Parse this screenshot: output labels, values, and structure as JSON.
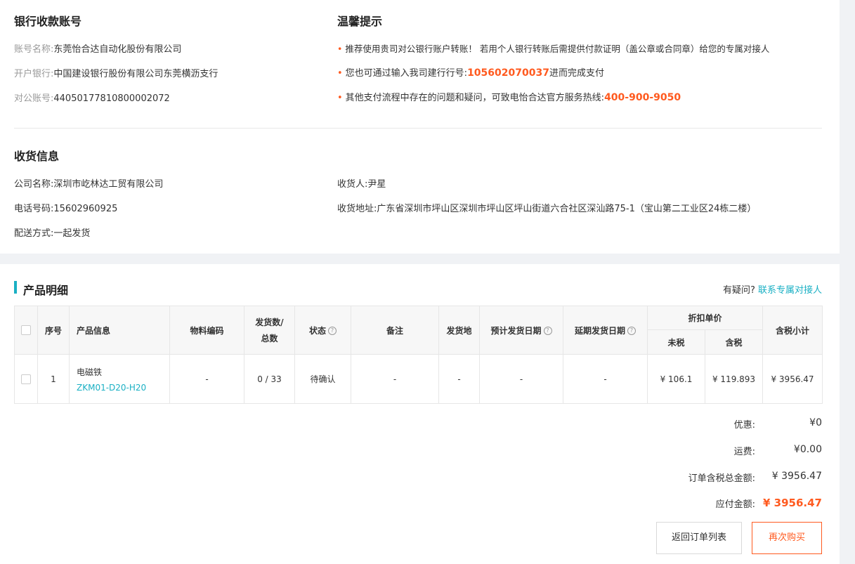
{
  "bank": {
    "title": "银行收款账号",
    "account_name_label": "账号名称:",
    "account_name": "东莞怡合达自动化股份有限公司",
    "bank_label": "开户银行:",
    "bank_name": "中国建设银行股份有限公司东莞横沥支行",
    "account_no_label": "对公账号:",
    "account_no": "44050177810800002072"
  },
  "tips": {
    "title": "温馨提示",
    "tip1": "推荐使用贵司对公银行账户转账！ 若用个人银行转账后需提供付款证明（盖公章或合同章）给您的专属对接人",
    "tip2_pre": "您也可通过输入我司建行行号:",
    "tip2_code": "105602070037",
    "tip2_post": "进而完成支付",
    "tip3_pre": "其他支付流程中存在的问题和疑问，可致电怡合达官方服务热线:",
    "tip3_phone": "400-900-9050"
  },
  "shipping": {
    "title": "收货信息",
    "company": "公司名称:深圳市屹林达工贸有限公司",
    "receiver": "收货人:尹星",
    "phone": "电话号码:15602960925",
    "address": "收货地址:广东省深圳市坪山区深圳市坪山区坪山街道六合社区深汕路75-1（宝山第二工业区24栋二楼）",
    "delivery": "配送方式:一起发货"
  },
  "products": {
    "title": "产品明细",
    "question": "有疑问?",
    "contact_link": "联系专属对接人",
    "headers": {
      "index": "序号",
      "info": "产品信息",
      "material": "物料编码",
      "qty_line1": "发货数/",
      "qty_line2": "总数",
      "status": "状态",
      "remark": "备注",
      "origin": "发货地",
      "est_date": "预计发货日期",
      "delay_date": "延期发货日期",
      "discount": "折扣单价",
      "no_tax": "未税",
      "with_tax": "含税",
      "subtotal": "含税小计"
    },
    "rows": [
      {
        "index": "1",
        "name": "电磁铁",
        "code": "ZKM01-D20-H20",
        "material": "-",
        "qty": "0 / 33",
        "status": "待确认",
        "remark": "-",
        "origin": "-",
        "est_date": "-",
        "delay_date": "-",
        "price_no_tax": "¥ 106.1",
        "price_tax": "¥ 119.893",
        "subtotal": "¥ 3956.47"
      }
    ]
  },
  "summary": {
    "discount_label": "优惠:",
    "discount_value": "¥0",
    "shipping_label": "运费:",
    "shipping_value": "¥0.00",
    "total_label": "订单含税总金额:",
    "total_value": "¥ 3956.47",
    "pay_label": "应付金额:",
    "pay_value": "¥ 3956.47"
  },
  "buttons": {
    "back": "返回订单列表",
    "buy_again": "再次购买"
  },
  "icons": {
    "help": "question-circle-icon",
    "checkbox": "checkbox-icon"
  },
  "colors": {
    "accent": "#ff5a1f",
    "link": "#1ab0c4"
  }
}
